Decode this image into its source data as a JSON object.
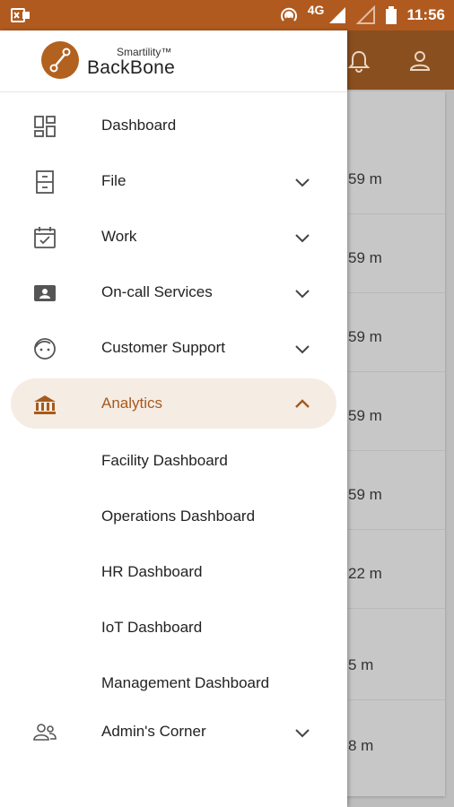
{
  "status_bar": {
    "network": "4G",
    "time": "11:56"
  },
  "content_times": [
    "59 m",
    "59 m",
    "59 m",
    "59 m",
    "59 m",
    "22 m",
    "5 m",
    "8 m"
  ],
  "drawer": {
    "logo": {
      "small": "Smartility™",
      "big": "BackBone"
    },
    "menu": [
      {
        "label": "Dashboard",
        "icon": "dashboard-icon"
      },
      {
        "label": "File",
        "icon": "file-cabinet-icon"
      },
      {
        "label": "Work",
        "icon": "calendar-check-icon"
      },
      {
        "label": "On-call Services",
        "icon": "id-card-icon"
      },
      {
        "label": "Customer Support",
        "icon": "support-agent-icon"
      },
      {
        "label": "Analytics",
        "icon": "bank-icon",
        "expanded": true
      },
      {
        "label": "Admin's Corner",
        "icon": "people-icon"
      }
    ],
    "analytics_sub": [
      "Facility Dashboard",
      "Operations Dashboard",
      "HR Dashboard",
      "IoT Dashboard",
      "Management Dashboard"
    ]
  },
  "colors": {
    "brand": "#b05a1f",
    "appbar": "#8a4f1f",
    "active_text": "#a65a1d",
    "active_pill": "#f5ece4"
  }
}
